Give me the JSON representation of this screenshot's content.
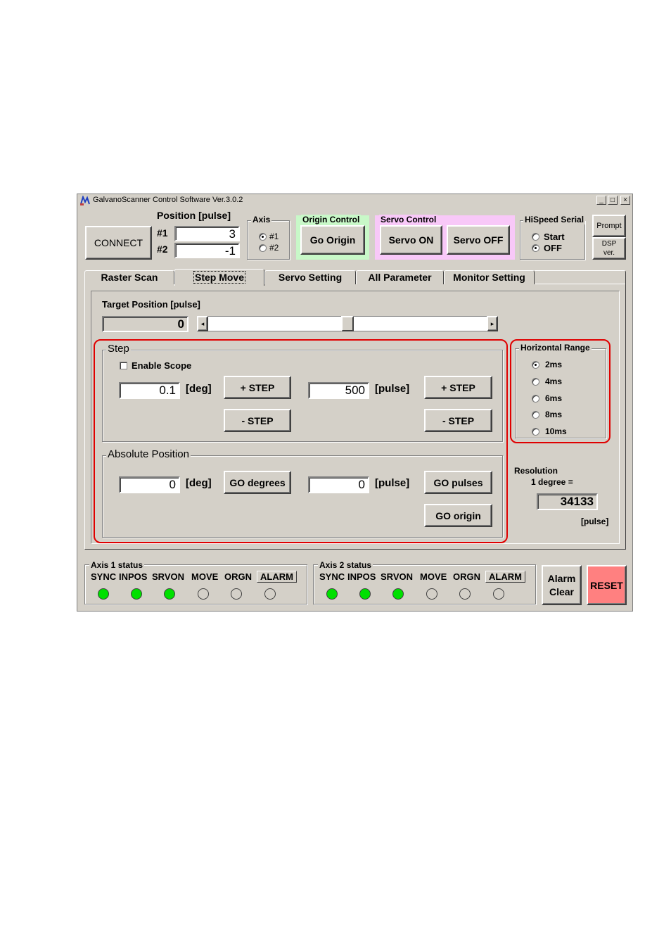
{
  "window": {
    "title": "GalvanoScanner Control Software Ver.3.0.2",
    "min_label": "_",
    "max_label": "□",
    "close_label": "×"
  },
  "header": {
    "connect_label": "CONNECT",
    "position_label": "Position [pulse]",
    "pos1_label": "#1",
    "pos1_value": "3",
    "pos2_label": "#2",
    "pos2_value": "-1",
    "axis_title": "Axis",
    "axis_opt1": "#1",
    "axis_opt2": "#2",
    "origin_title": "Origin Control",
    "go_origin_label": "Go Origin",
    "servo_title": "Servo Control",
    "servo_on_label": "Servo ON",
    "servo_off_label": "Servo OFF",
    "hispeed_title": "HiSpeed Serial",
    "hispeed_start": "Start",
    "hispeed_off": "OFF",
    "prompt_label": "Prompt",
    "dsp_label_1": "DSP",
    "dsp_label_2": "ver."
  },
  "tabs": [
    "Raster Scan",
    "Step Move",
    "Servo Setting",
    "All Parameter",
    "Monitor Setting"
  ],
  "target": {
    "label": "Target Position [pulse]",
    "value": "0",
    "left_arrow": "◂",
    "right_arrow": "▸"
  },
  "step": {
    "title": "Step",
    "enable_scope": "Enable Scope",
    "deg_value": "0.1",
    "deg_unit": "[deg]",
    "pulse_value": "500",
    "pulse_unit": "[pulse]",
    "plus_step": "+ STEP",
    "minus_step": "- STEP"
  },
  "absolute": {
    "title": "Absolute Position",
    "deg_value": "0",
    "deg_unit": "[deg]",
    "go_degrees": "GO degrees",
    "pulse_value": "0",
    "pulse_unit": "[pulse]",
    "go_pulses": "GO pulses",
    "go_origin": "GO origin"
  },
  "horizontal_range": {
    "title": "Horizontal Range",
    "options": [
      "2ms",
      "4ms",
      "6ms",
      "8ms",
      "10ms"
    ],
    "selected": "2ms"
  },
  "resolution": {
    "label": "Resolution",
    "sub": "1 degree =",
    "value": "34133",
    "unit": "[pulse]"
  },
  "axis1": {
    "title": "Axis 1 status",
    "labels": [
      "SYNC",
      "INPOS",
      "SRVON",
      "MOVE",
      "ORGN",
      "ALARM"
    ],
    "states": [
      true,
      true,
      true,
      false,
      false,
      false
    ]
  },
  "axis2": {
    "title": "Axis 2 status",
    "labels": [
      "SYNC",
      "INPOS",
      "SRVON",
      "MOVE",
      "ORGN",
      "ALARM"
    ],
    "states": [
      true,
      true,
      true,
      false,
      false,
      false
    ]
  },
  "footer": {
    "alarm_clear_1": "Alarm",
    "alarm_clear_2": "Clear",
    "reset_label": "RESET"
  },
  "colors": {
    "connect_bg": "#7cf77c",
    "reset_bg": "#ff8080",
    "origin_group_bg": "#c8f8c8",
    "servo_group_bg": "#f8c8f8",
    "highlight_red": "#e00000",
    "led_on": "#00e000"
  }
}
